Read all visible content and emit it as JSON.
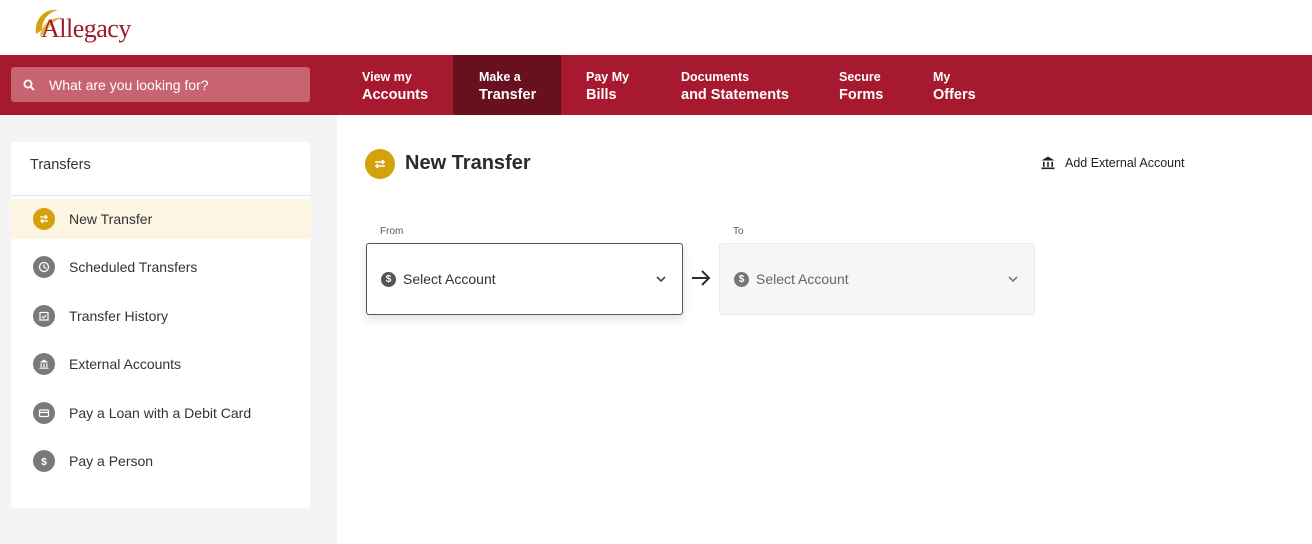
{
  "brand": {
    "logo_text": "Allegacy",
    "accent_color": "#a6192e",
    "gold_color": "#d4a10d"
  },
  "search": {
    "placeholder": "What are you looking for?",
    "icon": "search-icon"
  },
  "nav": {
    "items": [
      {
        "line1": "View my",
        "line2": "Accounts"
      },
      {
        "line1": "Make a",
        "line2": "Transfer",
        "active": true
      },
      {
        "line1": "Pay My",
        "line2": "Bills"
      },
      {
        "line1": "Documents",
        "line2": "and Statements"
      },
      {
        "line1": "Secure",
        "line2": "Forms"
      },
      {
        "line1": "My",
        "line2": "Offers"
      }
    ]
  },
  "sidebar": {
    "title": "Transfers",
    "items": [
      {
        "label": "New Transfer",
        "icon": "transfer-icon",
        "active": true
      },
      {
        "label": "Scheduled Transfers",
        "icon": "clock-icon"
      },
      {
        "label": "Transfer History",
        "icon": "calendar-icon"
      },
      {
        "label": "External Accounts",
        "icon": "bank-icon"
      },
      {
        "label": "Pay a Loan with a Debit Card",
        "icon": "card-icon"
      },
      {
        "label": "Pay a Person",
        "icon": "dollar-icon"
      }
    ]
  },
  "main": {
    "title": "New Transfer",
    "add_external": "Add External Account",
    "from": {
      "label": "From",
      "value": "Select Account"
    },
    "to": {
      "label": "To",
      "value": "Select Account"
    },
    "dollar_symbol": "$"
  }
}
